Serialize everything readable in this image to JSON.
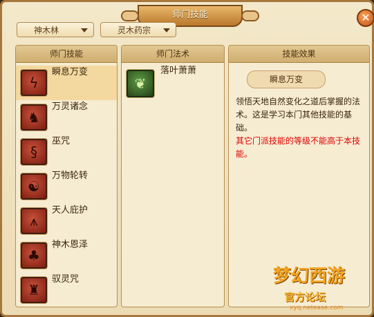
{
  "window": {
    "title": "师门技能",
    "close_label": "✕"
  },
  "filters": {
    "school": "神木林",
    "branch": "灵木药宗"
  },
  "panels": {
    "skills_header": "师门技能",
    "spells_header": "师门法术",
    "effect_header": "技能效果"
  },
  "skills": [
    {
      "label": "瞬息万变",
      "icon": "lightning-icon",
      "selected": true
    },
    {
      "label": "万灵诸念",
      "icon": "rabbit-icon",
      "selected": false
    },
    {
      "label": "巫咒",
      "icon": "swirl-rune-icon",
      "selected": false
    },
    {
      "label": "万物轮转",
      "icon": "yin-yang-icon",
      "selected": false
    },
    {
      "label": "天人庇护",
      "icon": "praying-hands-icon",
      "selected": false
    },
    {
      "label": "神木恩泽",
      "icon": "tree-icon",
      "selected": false
    },
    {
      "label": "驭灵咒",
      "icon": "spirit-head-icon",
      "selected": false
    }
  ],
  "spells": [
    {
      "label": "落叶萧萧",
      "icon": "leaf-swirl-icon"
    }
  ],
  "effect": {
    "name": "瞬息万变",
    "description": "领悟天地自然变化之道后掌握的法术。这是学习本门其他技能的基础。",
    "warning": "其它门派技能的等级不能高于本技能。"
  },
  "logo": {
    "title": "梦幻西游",
    "subtitle": "官方论坛",
    "url": "xyq.netease.com"
  },
  "colors": {
    "accent": "#b9782c",
    "warning": "#e00000",
    "selected_row": "#f3d9a0"
  }
}
